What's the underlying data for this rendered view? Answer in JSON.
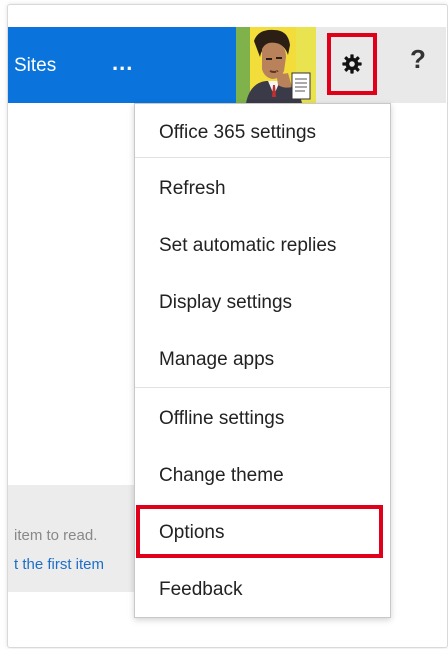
{
  "topbar": {
    "sites_label": "Sites",
    "more_label": "...",
    "help_label": "?"
  },
  "menu": {
    "items": [
      {
        "label": "Office 365 settings"
      },
      {
        "label": "Refresh"
      },
      {
        "label": "Set automatic replies"
      },
      {
        "label": "Display settings"
      },
      {
        "label": "Manage apps"
      },
      {
        "label": "Offline settings"
      },
      {
        "label": "Change theme"
      },
      {
        "label": "Options"
      },
      {
        "label": "Feedback"
      }
    ]
  },
  "reading_pane": {
    "hint_line1": "item to read.",
    "hint_line2": "t the first item"
  },
  "colors": {
    "accent_blue": "#0a74dc",
    "highlight_red": "#e1001a",
    "bar_gray": "#e9e9e9"
  },
  "icons": {
    "settings": "gear-icon",
    "help": "help-icon"
  }
}
